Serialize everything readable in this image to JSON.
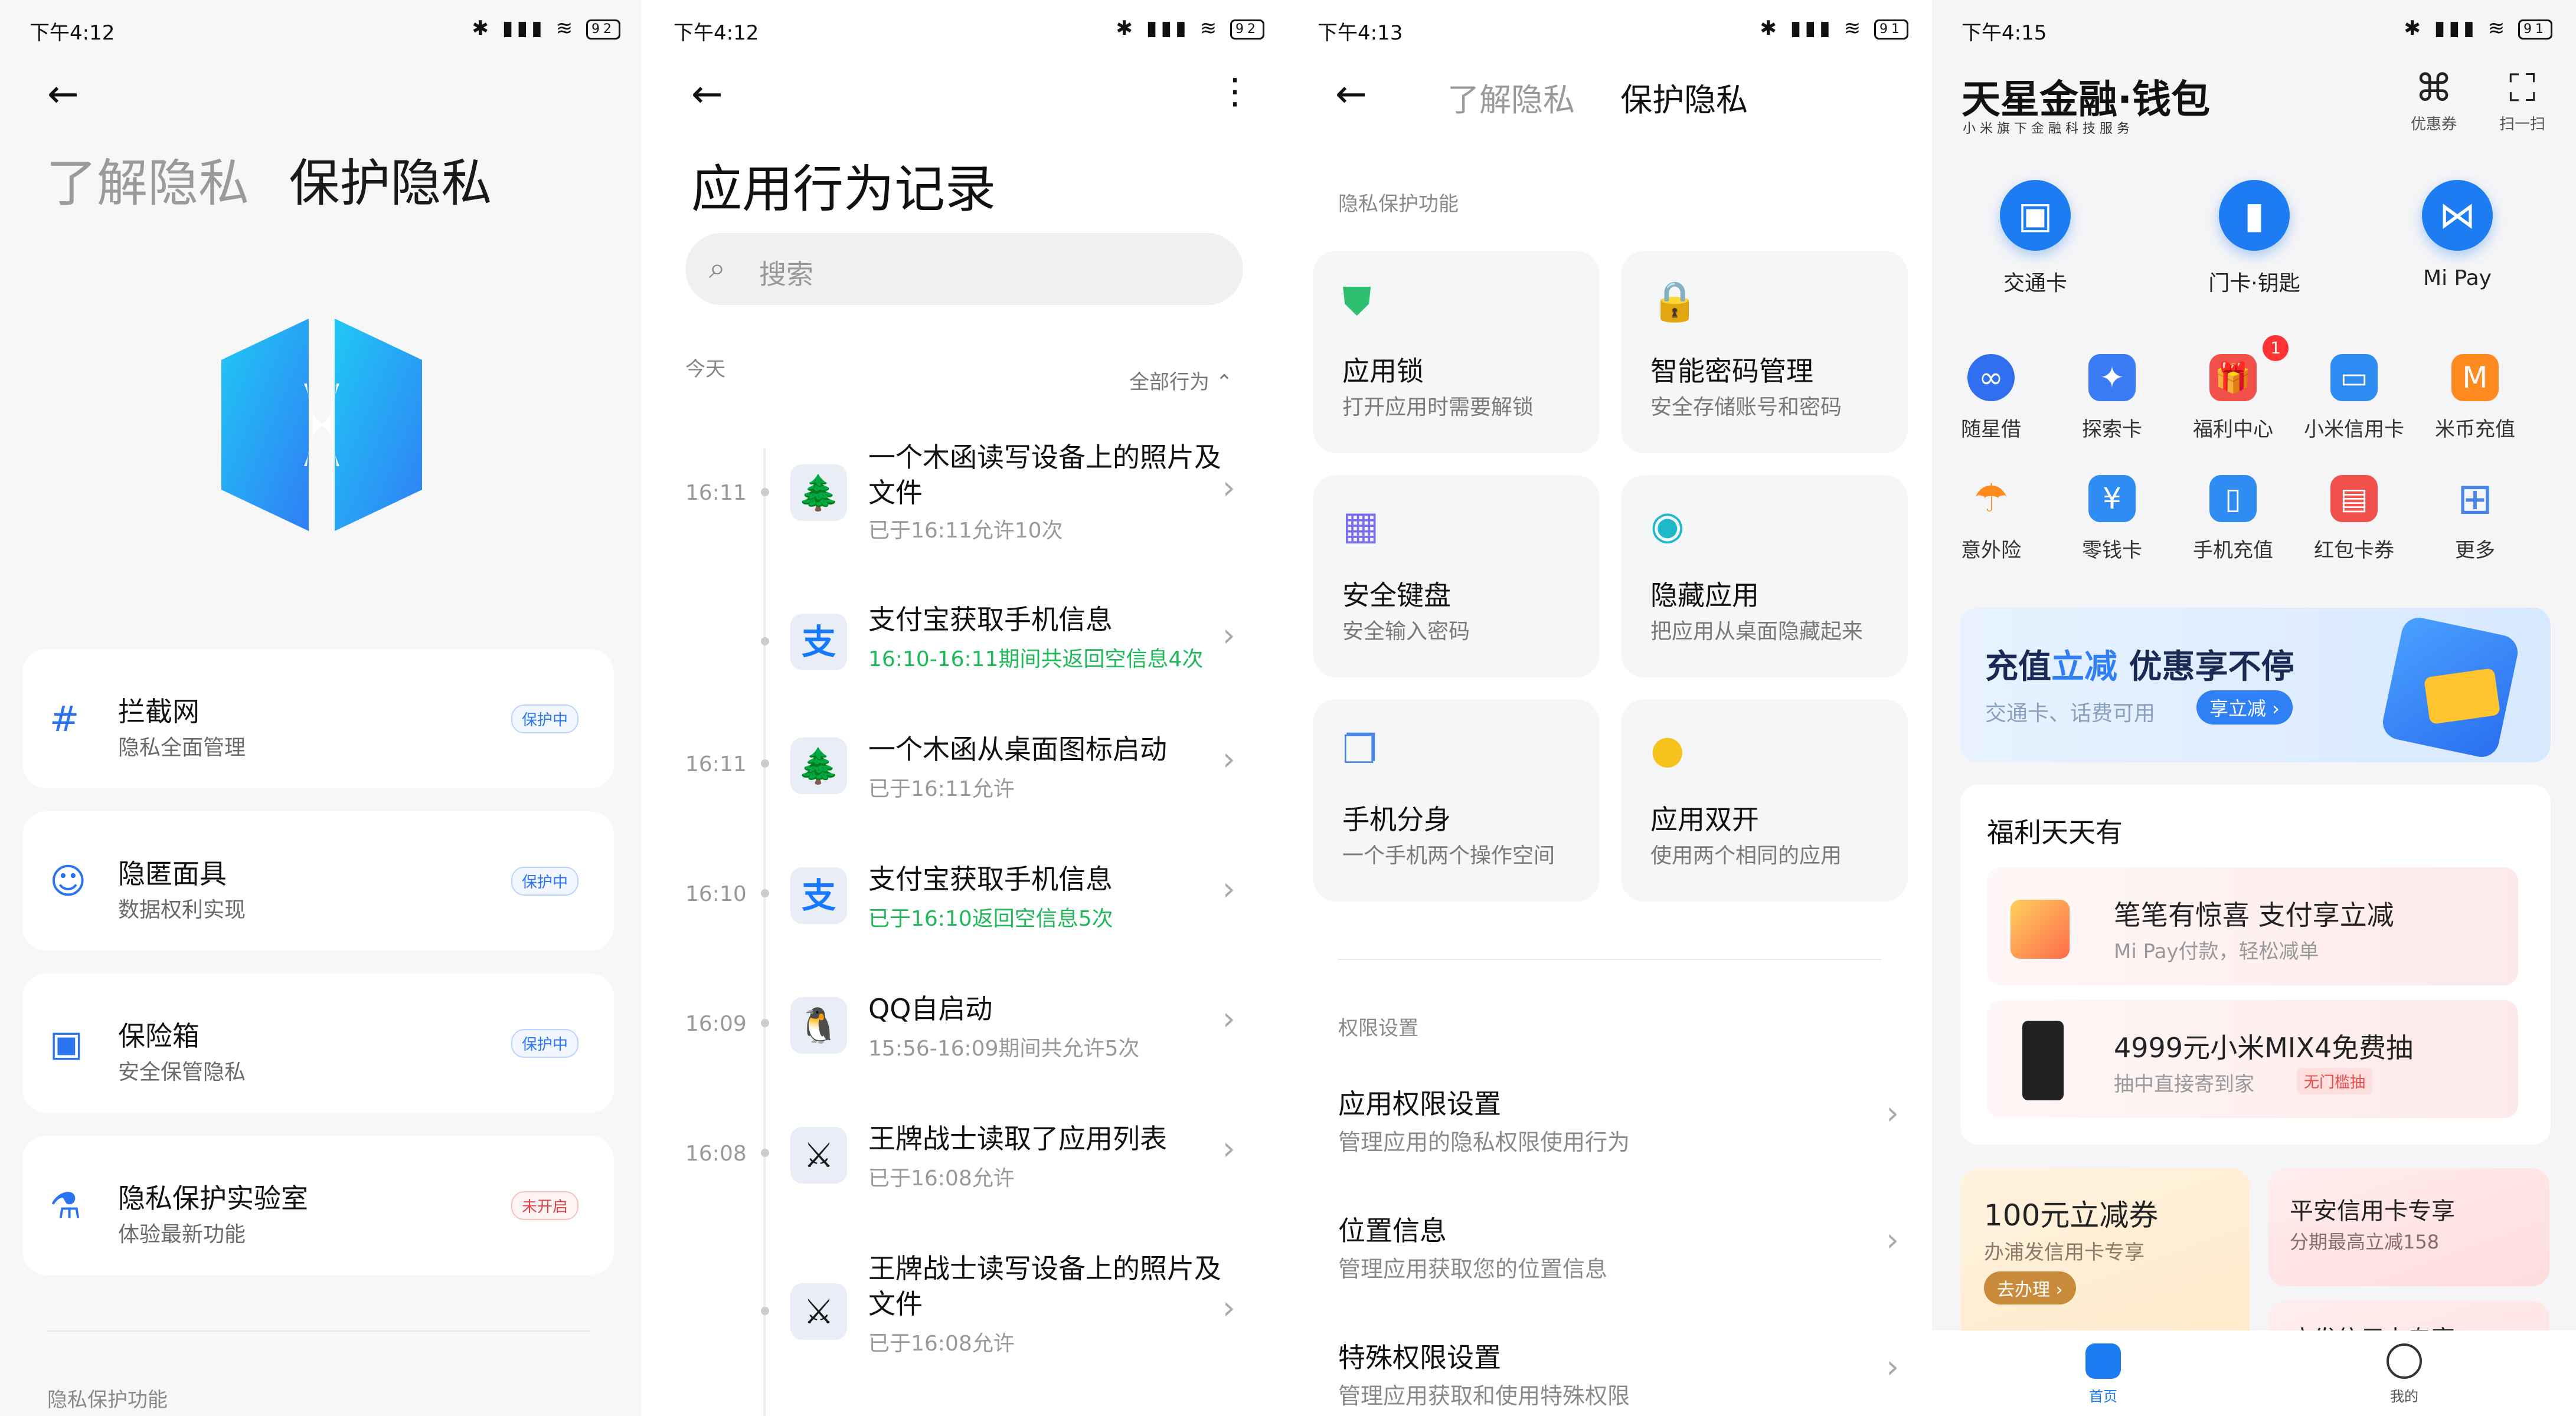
{
  "p1": {
    "status": {
      "time": "下午4:12",
      "battery": "92"
    },
    "tab_dim": "了解隐私",
    "tab_active": "保护隐私",
    "logo_icon": "shield-logo-icon",
    "items": [
      {
        "title": "拦截网",
        "subtitle": "隐私全面管理",
        "badge": "保护中",
        "icon": "#"
      },
      {
        "title": "隐匿面具",
        "subtitle": "数据权利实现",
        "badge": "保护中",
        "icon": "☺"
      },
      {
        "title": "保险箱",
        "subtitle": "安全保管隐私",
        "badge": "保护中",
        "icon": "▣"
      },
      {
        "title": "隐私保护实验室",
        "subtitle": "体验最新功能",
        "badge": "未开启",
        "icon": "⚗"
      }
    ],
    "section": "隐私保护功能"
  },
  "p2": {
    "status": {
      "time": "下午4:12",
      "battery": "92"
    },
    "title": "应用行为记录",
    "search_placeholder": "搜索",
    "today": "今天",
    "filter": "全部行为 ⌃",
    "records": [
      {
        "time": "16:11",
        "app": "🌲",
        "title": "一个木函读写设备上的照片及文件",
        "sub": "已于16:11允许10次",
        "green": false
      },
      {
        "time": "",
        "app": "支",
        "title": "支付宝获取手机信息",
        "sub": "16:10-16:11期间共返回空信息4次",
        "green": true
      },
      {
        "time": "16:11",
        "app": "🌲",
        "title": "一个木函从桌面图标启动",
        "sub": "已于16:11允许",
        "green": false
      },
      {
        "time": "16:10",
        "app": "支",
        "title": "支付宝获取手机信息",
        "sub": "已于16:10返回空信息5次",
        "green": true
      },
      {
        "time": "16:09",
        "app": "🐧",
        "title": "QQ自启动",
        "sub": "15:56-16:09期间共允许5次",
        "green": false
      },
      {
        "time": "16:08",
        "app": "⚔",
        "title": "王牌战士读取了应用列表",
        "sub": "已于16:08允许",
        "green": false
      },
      {
        "time": "",
        "app": "⚔",
        "title": "王牌战士读写设备上的照片及文件",
        "sub": "已于16:08允许",
        "green": false
      }
    ]
  },
  "p3": {
    "status": {
      "time": "下午4:13",
      "battery": "91"
    },
    "tab_dim": "了解隐私",
    "tab_active": "保护隐私",
    "section1": "隐私保护功能",
    "features": [
      {
        "title": "应用锁",
        "sub": "打开应用时需要解锁",
        "icon": "⛊",
        "color": "#2fbf71"
      },
      {
        "title": "智能密码管理",
        "sub": "安全存储账号和密码",
        "icon": "🔒",
        "color": "#f2683c"
      },
      {
        "title": "安全键盘",
        "sub": "安全输入密码",
        "icon": "▦",
        "color": "#7b6cf0"
      },
      {
        "title": "隐藏应用",
        "sub": "把应用从桌面隐藏起来",
        "icon": "◉",
        "color": "#1fb8c9"
      },
      {
        "title": "手机分身",
        "sub": "一个手机两个操作空间",
        "icon": "❐",
        "color": "#4a86e8"
      },
      {
        "title": "应用双开",
        "sub": "使用两个相同的应用",
        "icon": "●",
        "color": "#f5c31b"
      }
    ],
    "section2": "权限设置",
    "perms": [
      {
        "title": "应用权限设置",
        "sub": "管理应用的隐私权限使用行为"
      },
      {
        "title": "位置信息",
        "sub": "管理应用获取您的位置信息"
      },
      {
        "title": "特殊权限设置",
        "sub": "管理应用获取和使用特殊权限"
      }
    ]
  },
  "p4": {
    "status": {
      "time": "下午4:15",
      "battery": "91"
    },
    "brand": "天星金融·钱包",
    "brand_sub": "小 米 旗 下 金 融 科 技 服 务",
    "top_icons": [
      {
        "label": "优惠券",
        "glyph": "⌘"
      },
      {
        "label": "扫一扫",
        "glyph": "⛶"
      }
    ],
    "quick": [
      {
        "label": "交通卡",
        "glyph": "▣"
      },
      {
        "label": "门卡·钥匙",
        "glyph": "▮"
      },
      {
        "label": "Mi Pay",
        "glyph": "⋈"
      }
    ],
    "grid": [
      {
        "label": "随星借",
        "glyph": "∞",
        "color": "#2f6ff0"
      },
      {
        "label": "探索卡",
        "glyph": "✦",
        "color": "#3b7cf5"
      },
      {
        "label": "福利中心",
        "glyph": "🎁",
        "color": "#f2504b"
      },
      {
        "label": "小米信用卡",
        "glyph": "▭",
        "color": "#2e8cf3"
      },
      {
        "label": "米币充值",
        "glyph": "M",
        "color": "#ff8a1f"
      },
      {
        "label": "意外险",
        "glyph": "☂",
        "color": "#ff8a1f"
      },
      {
        "label": "零钱卡",
        "glyph": "¥",
        "color": "#2e8cf3"
      },
      {
        "label": "手机充值",
        "glyph": "▯",
        "color": "#2e8cf3"
      },
      {
        "label": "红包卡券",
        "glyph": "▤",
        "color": "#f2504b"
      },
      {
        "label": "更多",
        "glyph": "⊞",
        "color": "#4a86e8"
      }
    ],
    "badge_count": "1",
    "banner": {
      "title_a": "充值",
      "title_b": "立减",
      "title_c": " 优惠享不停",
      "sub": "交通卡、话费可用",
      "btn": "享立减 ›"
    },
    "welfare": {
      "title": "福利天天有",
      "rows": [
        {
          "title": "笔笔有惊喜 支付享立减",
          "sub": "Mi Pay付款，轻松减单",
          "tag": ""
        },
        {
          "title": "4999元小米MIX4免费抽",
          "sub": "抽中直接寄到家",
          "tag": "无门槛抽"
        }
      ]
    },
    "promo1": {
      "title": "100元立减券",
      "sub": "办浦发信用卡专享",
      "btn": "去办理 ›"
    },
    "promo2": {
      "title": "平安信用卡专享",
      "sub": "分期最高立减158"
    },
    "promo3": {
      "title": "广发信用卡专享"
    },
    "tabs": [
      {
        "label": "首页"
      },
      {
        "label": "我的"
      }
    ]
  }
}
